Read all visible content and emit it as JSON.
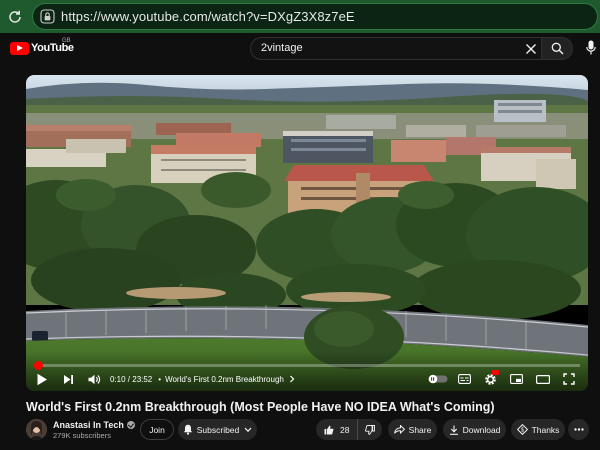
{
  "browser": {
    "url": "https://www.youtube.com/watch?v=DXgZ3X8z7eE"
  },
  "masthead": {
    "logo_text": "YouTube",
    "region": "GB",
    "search_value": "2vintage"
  },
  "player": {
    "progress": 0.007,
    "time_display": "0:10 / 23:52",
    "chapter": "World's First 0.2nm Breakthrough"
  },
  "video": {
    "title": "World's First 0.2nm Breakthrough (Most People Have NO IDEA What's Coming)",
    "channel_name": "Anastasi In Tech",
    "subscribers": "279K subscribers"
  },
  "actions": {
    "join": "Join",
    "subscribed": "Subscribed",
    "likes": "28",
    "share": "Share",
    "download": "Download",
    "thanks": "Thanks"
  },
  "icons": {
    "reload": "reload-icon",
    "lock": "lock-icon",
    "search": "search-icon",
    "clear": "close-icon",
    "mic": "mic-icon",
    "play": "play-icon",
    "next": "next-icon",
    "volume": "volume-icon",
    "autoplay": "autoplay-toggle-icon",
    "subtitles": "subtitles-icon",
    "settings": "gear-icon",
    "miniplayer": "miniplayer-icon",
    "theater": "theater-icon",
    "fullscreen": "fullscreen-icon",
    "bell": "bell-icon",
    "like": "thumbs-up-icon",
    "dislike": "thumbs-down-icon",
    "share": "share-icon",
    "download": "download-icon",
    "thanks": "thanks-icon",
    "more": "more-icon"
  },
  "colors": {
    "browser_bar": "#1e5a2e",
    "yt_red": "#ff0000",
    "background": "#0f0f0f",
    "button": "#272727"
  }
}
